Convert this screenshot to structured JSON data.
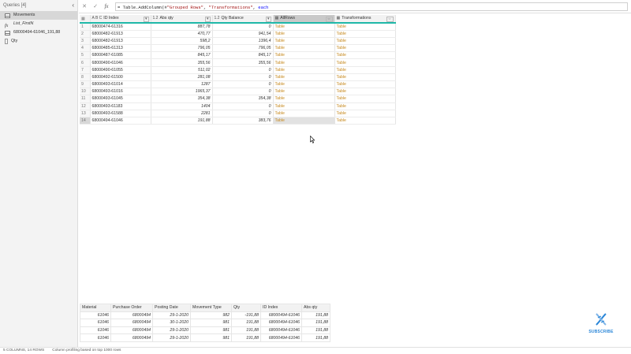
{
  "queries": {
    "header": "Queries [4]",
    "items": [
      {
        "label": "Movements",
        "icon": "table-icon",
        "active": true
      },
      {
        "label": "List_FirstN",
        "icon": "function-icon",
        "italic": true
      },
      {
        "label": "68000494-61046_191,88",
        "icon": "table-icon"
      },
      {
        "label": "Qty",
        "icon": "value-icon"
      }
    ]
  },
  "formula_bar": {
    "cancel": "✕",
    "commit": "✓",
    "fx": "fx",
    "prefix": "= Table.AddColumn(#",
    "str1": "\"Grouped Rows\"",
    "mid": ", ",
    "str2": "\"Transformations\"",
    "sep": ", ",
    "kw": "each"
  },
  "main_table": {
    "columns": [
      {
        "type": "A B C",
        "name": "ID Index"
      },
      {
        "type": "1.2",
        "name": "Abs qty"
      },
      {
        "type": "1.2",
        "name": "Qty Balance"
      },
      {
        "type": "",
        "name": "AllRows"
      },
      {
        "type": "",
        "name": "Transformations"
      }
    ],
    "rows": [
      [
        "1",
        "68000474-61316",
        "887,78",
        "0",
        "Table",
        "Table"
      ],
      [
        "2",
        "68000482-61913",
        "470,77",
        "941,54",
        "Table",
        "Table"
      ],
      [
        "3",
        "68000482-61913",
        "598,2",
        "1396,4",
        "Table",
        "Table"
      ],
      [
        "4",
        "68000485-61313",
        "796,05",
        "796,05",
        "Table",
        "Table"
      ],
      [
        "5",
        "68000487-61085",
        "845,17",
        "845,17",
        "Table",
        "Table"
      ],
      [
        "6",
        "68000490-61046",
        "355,56",
        "355,56",
        "Table",
        "Table"
      ],
      [
        "7",
        "68000490-61055",
        "511,02",
        "0",
        "Table",
        "Table"
      ],
      [
        "8",
        "68000492-61500",
        "281,08",
        "0",
        "Table",
        "Table"
      ],
      [
        "9",
        "68000493-61014",
        "1287",
        "0",
        "Table",
        "Table"
      ],
      [
        "10",
        "68000493-61016",
        "1965,37",
        "0",
        "Table",
        "Table"
      ],
      [
        "11",
        "68000493-61045",
        "354,38",
        "354,38",
        "Table",
        "Table"
      ],
      [
        "12",
        "68000493-61183",
        "1404",
        "0",
        "Table",
        "Table"
      ],
      [
        "13",
        "68000493-61588",
        "2281",
        "0",
        "Table",
        "Table"
      ],
      [
        "14",
        "68000494-61046",
        "191,88",
        "383,76",
        "Table",
        "Table"
      ]
    ]
  },
  "preview_table": {
    "columns": [
      "Material",
      "Purchase Order",
      "Posting Date",
      "Movement Type",
      "Qty",
      "ID Index",
      "Abs qty"
    ],
    "rows": [
      [
        "61046",
        "68000494",
        "29-1-2020",
        "982",
        "-191,88",
        "68000494-61046",
        "191,88"
      ],
      [
        "61046",
        "68000494",
        "30-1-2020",
        "981",
        "191,88",
        "68000494-61046",
        "191,88"
      ],
      [
        "61046",
        "68000494",
        "29-1-2020",
        "981",
        "191,88",
        "68000494-61046",
        "191,88"
      ],
      [
        "61046",
        "68000494",
        "29-1-2020",
        "981",
        "191,88",
        "68000494-61046",
        "191,88"
      ]
    ]
  },
  "subscribe": {
    "label": "SUBSCRIBE"
  },
  "status_bar": {
    "left": "5 COLUMNS, 14 ROWS",
    "right": "Column profiling based on top 1000 rows"
  },
  "colors": {
    "accent": "#1fb8a8",
    "table_link": "#c78a20",
    "subscribe": "#2a86d8"
  }
}
